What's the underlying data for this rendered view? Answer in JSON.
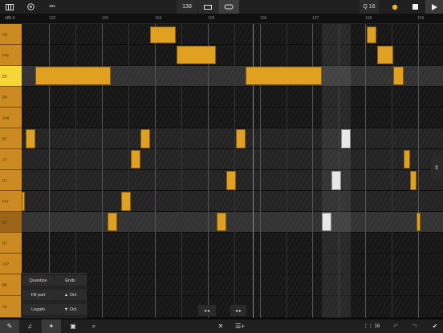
{
  "toolbar": {
    "menu_icon": "piano-roll-icon",
    "settings_icon": "settings-icon",
    "more_icon": "more-icon",
    "tempo": "138",
    "quantize_label": "Q 16",
    "record_color": "#e8b030"
  },
  "ruler": {
    "position": "185.4",
    "ticks": [
      "102",
      "103",
      "104",
      "105",
      "106",
      "107",
      "108",
      "109"
    ]
  },
  "keys": [
    "G8",
    "F#8",
    "E8",
    "D8",
    "C#8",
    "B7",
    "A7",
    "G7",
    "F#7",
    "E7",
    "D7",
    "C#7",
    "B6",
    "A6"
  ],
  "popup": {
    "quantize": "Quantize",
    "ends": "Ends",
    "fill_part": "Fill part",
    "oct_up": "▲ Oct",
    "legato": "Legato",
    "oct_down": "▼ Oct"
  },
  "nav": {
    "left": "◂ ▸",
    "right": "◂ ▸"
  },
  "bottombar": {
    "grid_label": "16"
  },
  "colors": {
    "note": "#e0a020",
    "note_selected": "#e8e8e8",
    "key": "#cc8a22",
    "key_selected": "#f5d63a"
  }
}
